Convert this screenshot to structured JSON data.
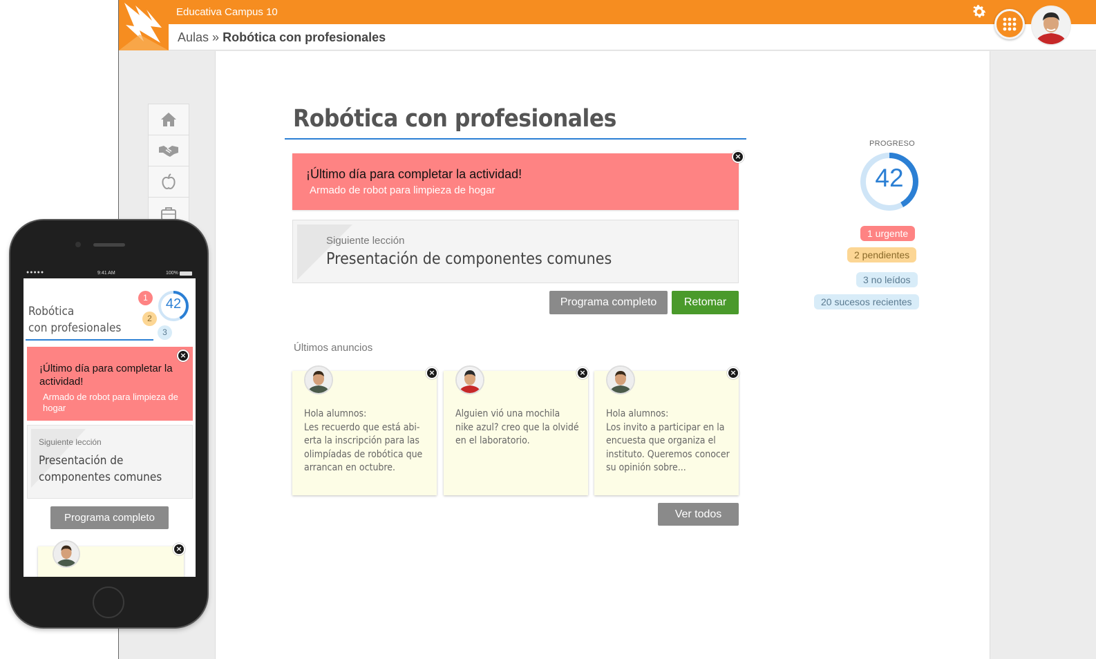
{
  "app": {
    "title": "Educativa Campus 10"
  },
  "breadcrumb": {
    "parent": "Aulas",
    "separator": "»",
    "current": "Robótica con profesionales"
  },
  "course": {
    "title": "Robótica con profesionales"
  },
  "alert": {
    "title": "¡Último día para completar la actividad!",
    "subtitle": "Armado de robot para limpieza de hogar",
    "close": "×"
  },
  "next_lesson": {
    "label": "Siguiente lección",
    "title": "Presentación de componentes comunes"
  },
  "buttons": {
    "programa": "Programa completo",
    "retomar": "Retomar",
    "ver_todos": "Ver todos"
  },
  "announcements": {
    "heading": "Últimos anuncios",
    "items": [
      {
        "text": "Hola alumnos:\nLes recuerdo que está abi-erta la inscripción para las olimpíadas de robótica que arrancan en octubre.",
        "close": "×"
      },
      {
        "text": "Alguien vió una mochila nike azul? creo que la olvidé en el laboratorio.",
        "close": "×"
      },
      {
        "text": "Hola alumnos:\nLos invito a participar en la encuesta que organiza el instituto. Queremos conocer su opinión sobre...",
        "close": "×"
      }
    ]
  },
  "progress": {
    "label": "PROGRESO",
    "value": 42,
    "fraction": 0.42,
    "badges": {
      "urgent": "1 urgente",
      "pending": "2 pendientes",
      "unread": "3 no leídos",
      "events": "20 sucesos recientes"
    }
  },
  "mobile": {
    "status_time": "9:41 AM",
    "status_battery": "100%",
    "title_line1": "Robótica",
    "title_line2": "con profesionales",
    "progress": 42,
    "badges": [
      "1",
      "2",
      "3"
    ],
    "alert_title": "¡Último día para completar la actividad!",
    "alert_sub": "Armado de robot para limpieza de hogar",
    "next_label": "Siguiente lección",
    "next_title": "Presentación de componentes comunes",
    "button": "Programa completo",
    "close": "×"
  },
  "colors": {
    "brand": "#f68d20",
    "accent": "#2b7fd4",
    "alert": "#fe8383",
    "success": "#4a9a2b",
    "note": "#fdfde6"
  },
  "icons": [
    "logo-icon",
    "gear-icon",
    "apps-grid-icon",
    "home-icon",
    "handshake-icon",
    "apple-icon",
    "briefcase-icon",
    "close-icon"
  ]
}
